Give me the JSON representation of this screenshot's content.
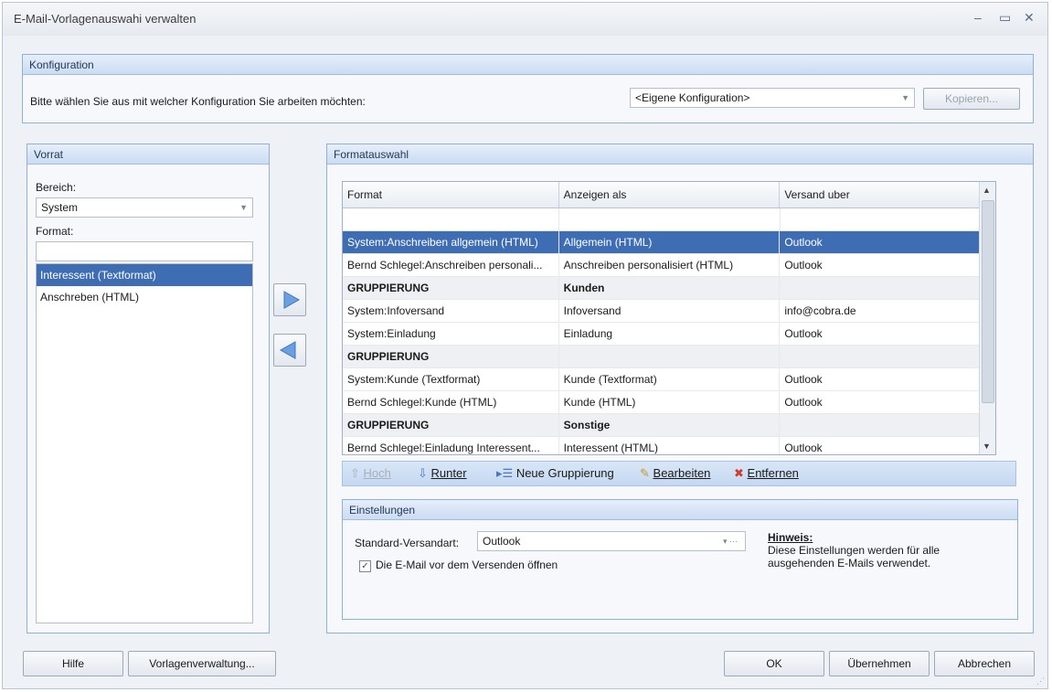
{
  "window": {
    "title": "E-Mail-Vorlagenauswahi verwalten",
    "controls": [
      "–",
      "▭",
      "✕"
    ]
  },
  "config": {
    "group_title": "Konfiguration",
    "prompt": "Bitte wählen Sie aus mit welcher Konfiguration Sie arbeiten möchten:",
    "selected": "<Eigene Konfiguration>",
    "copy_button": "Kopieren..."
  },
  "vorrat": {
    "group_title": "Vorrat",
    "bereich_label": "Bereich:",
    "bereich_value": "System",
    "format_label": "Format:",
    "format_filter": "",
    "items": [
      {
        "label": "Interessent (Textformat)",
        "selected": true
      },
      {
        "label": "Anschreben (HTML)",
        "selected": false
      }
    ]
  },
  "transfer": {
    "add_icon": "arrow-right-icon",
    "remove_icon": "arrow-left-icon"
  },
  "formatauswahl": {
    "group_title": "Formatauswahl",
    "columns": [
      "Format",
      "Anzeigen als",
      "Versand uber"
    ],
    "rows": [
      {
        "format": "System:Anschreiben allgemein (HTML)",
        "anzeigen": "Allgemein (HTML)",
        "versand": "Outlook",
        "type": "selected"
      },
      {
        "format": "Bernd Schlegel:Anschreiben personali...",
        "anzeigen": "Anschreiben personalisiert (HTML)",
        "versand": "Outlook",
        "type": "normal"
      },
      {
        "format": "GRUPPIERUNG",
        "anzeigen": "Kunden",
        "versand": "",
        "type": "group"
      },
      {
        "format": "System:Infoversand",
        "anzeigen": "Infoversand",
        "versand": "info@cobra.de",
        "type": "normal"
      },
      {
        "format": "System:Einladung",
        "anzeigen": "Einladung",
        "versand": "Outlook",
        "type": "normal"
      },
      {
        "format": "GRUPPIERUNG",
        "anzeigen": "",
        "versand": "",
        "type": "group"
      },
      {
        "format": "System:Kunde (Textformat)",
        "anzeigen": "Kunde (Textformat)",
        "versand": "Outlook",
        "type": "normal"
      },
      {
        "format": "Bernd Schlegel:Kunde (HTML)",
        "anzeigen": "Kunde (HTML)",
        "versand": "Outlook",
        "type": "normal"
      },
      {
        "format": "GRUPPIERUNG",
        "anzeigen": "Sonstige",
        "versand": "",
        "type": "group"
      },
      {
        "format": "Bernd Schlegel:Einladung Interessent...",
        "anzeigen": "Interessent (HTML)",
        "versand": "Outlook",
        "type": "normal"
      }
    ],
    "toolbar": {
      "up": "Hoch",
      "down": "Runter",
      "new_group": "Neue Gruppierung",
      "edit": "Bearbeiten",
      "remove": "Entfernen"
    }
  },
  "einstellungen": {
    "group_title": "Einstellungen",
    "versandart_label": "Standard-Versandart:",
    "versandart_value": "Outlook",
    "checkbox_label": "Die E-Mail vor dem Versenden öffnen",
    "checkbox_checked": true,
    "hint_title": "Hinweis:",
    "hint_text_1": "Diese Einstellungen werden für alle",
    "hint_text_2": "ausgehenden E-Mails verwendet."
  },
  "footer": {
    "help": "Hilfe",
    "templates": "Vorlagenverwaltung...",
    "ok": "OK",
    "apply": "Übernehmen",
    "cancel": "Abbrechen"
  }
}
